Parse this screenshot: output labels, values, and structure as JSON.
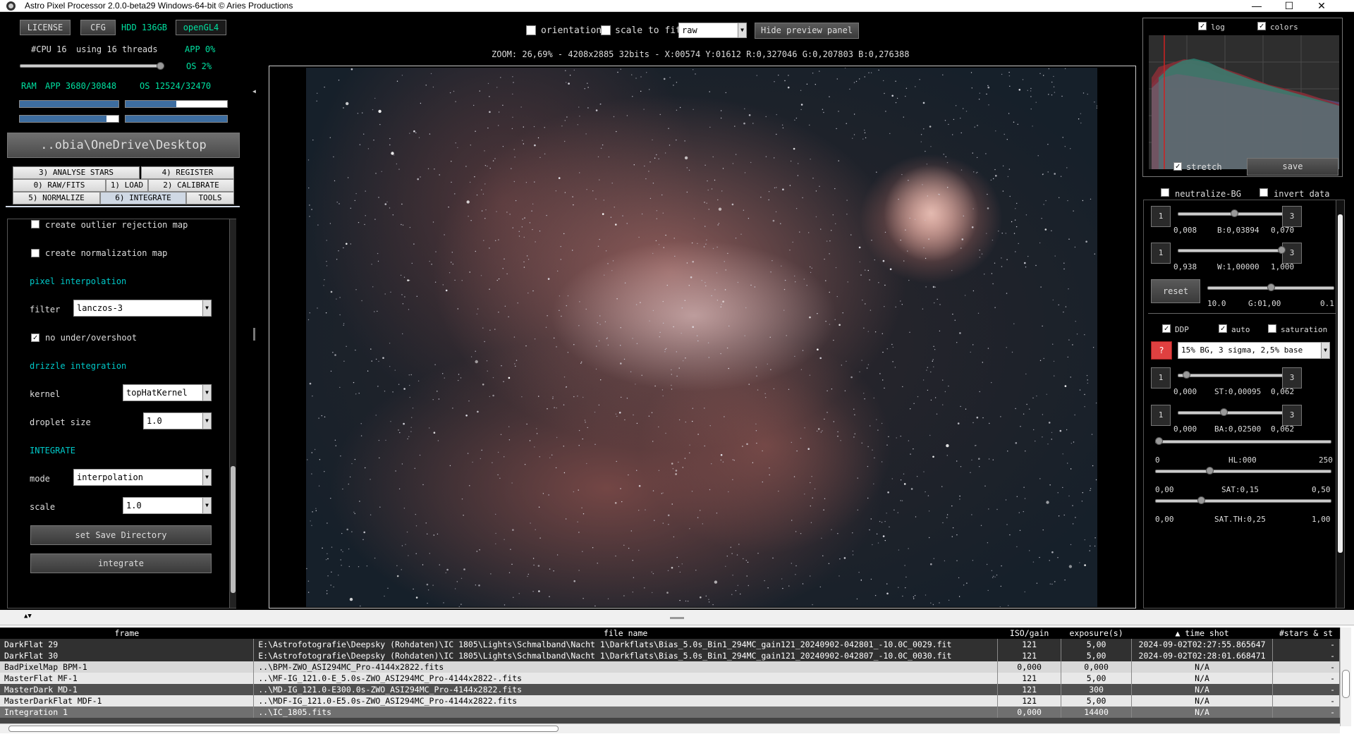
{
  "window": {
    "title": "Astro Pixel Processor 2.0.0-beta29 Windows-64-bit © Aries Productions",
    "minimize": "—",
    "maximize": "☐",
    "close": "✕"
  },
  "toolbar": {
    "license": "LICENSE",
    "cfg": "CFG",
    "hdd": "HDD 136GB",
    "opengl": "openGL4"
  },
  "sysinfo": {
    "cpu": "#CPU 16",
    "threads": "using 16 threads",
    "app_pct": "APP 0%",
    "os_pct": "OS 2%",
    "ram_label": "RAM",
    "ram_app": "APP 3680/30848",
    "ram_os": "OS 12524/32470",
    "thread_slider": 1.0
  },
  "path": "..obia\\OneDrive\\Desktop",
  "tabs": {
    "row1": [
      "3) ANALYSE STARS",
      "4) REGISTER"
    ],
    "row2": [
      "0) RAW/FITS",
      "1) LOAD",
      "2) CALIBRATE"
    ],
    "row3": [
      "5) NORMALIZE",
      "6) INTEGRATE",
      "TOOLS"
    ],
    "active": "6) INTEGRATE"
  },
  "integrate_panel": {
    "outlier_map": "create outlier rejection map",
    "norm_map": "create normalization map",
    "pixel_interp_heading": "pixel interpolation",
    "filter_label": "filter",
    "filter_value": "lanczos-3",
    "no_overshoot": "no under/overshoot",
    "drizzle_heading": "drizzle integration",
    "kernel_label": "kernel",
    "kernel_value": "topHatKernel",
    "droplet_label": "droplet size",
    "droplet_value": "1.0",
    "integrate_heading": "INTEGRATE",
    "mode_label": "mode",
    "mode_value": "interpolation",
    "scale_label": "scale",
    "scale_value": "1.0",
    "save_dir_btn": "set Save Directory",
    "integrate_btn": "integrate"
  },
  "preview": {
    "orientation": "orientation",
    "scale_to_fit": "scale to fit",
    "mode": "raw",
    "hide_btn": "Hide preview panel",
    "zoom_info": "ZOOM: 26,69% - 4208x2885 32bits - X:00574 Y:01612 R:0,327046 G:0,207803 B:0,276388"
  },
  "histogram": {
    "log": "log",
    "colors": "colors"
  },
  "right_panel": {
    "stretch": "stretch",
    "save": "save",
    "neutralize": "neutralize-BG",
    "invert": "invert data",
    "b_min": "0,008",
    "b_val": "B:0,03894",
    "b_max": "0,070",
    "b_pos": 0.5,
    "w_min": "0,938",
    "w_val": "W:1,00000",
    "w_max": "1,000",
    "w_pos": 0.95,
    "reset": "reset",
    "g_min": "10.0",
    "g_val": "G:01,00",
    "g_max": "0.1",
    "g_pos": 0.5,
    "ddp": "DDP",
    "auto": "auto",
    "saturation": "saturation",
    "help": "?",
    "preset": "15% BG, 3 sigma, 2,5% base",
    "st_min": "0,000",
    "st_val": "ST:0,00095",
    "st_max": "0,062",
    "st_pos": 0.05,
    "ba_min": "0,000",
    "ba_val": "BA:0,02500",
    "ba_max": "0,062",
    "ba_pos": 0.4,
    "hl_min": "0",
    "hl_val": "HL:000",
    "hl_max": "250",
    "hl_pos": 0.0,
    "sat_min": "0,00",
    "sat_val": "SAT:0,15",
    "sat_max": "0,50",
    "sat_pos": 0.3,
    "satth_min": "0,00",
    "satth_val": "SAT.TH:0,25",
    "satth_max": "1,00",
    "satth_pos": 0.25,
    "step1": "1",
    "step3": "3"
  },
  "file_table": {
    "headers": [
      "frame",
      "file name",
      "ISO/gain",
      "exposure(s)",
      "▲ time shot",
      "#stars & st"
    ],
    "rows": [
      [
        "DarkFlat 29",
        "E:\\Astrofotografie\\Deepsky (Rohdaten)\\IC 1805\\Lights\\Schmalband\\Nacht 1\\Darkflats\\Bias_5.0s_Bin1_294MC_gain121_20240902-042801_-10.0C_0029.fit",
        "121",
        "5,00",
        "2024-09-02T02:27:55.865647",
        "-"
      ],
      [
        "DarkFlat 30",
        "E:\\Astrofotografie\\Deepsky (Rohdaten)\\IC 1805\\Lights\\Schmalband\\Nacht 1\\Darkflats\\Bias_5.0s_Bin1_294MC_gain121_20240902-042807_-10.0C_0030.fit",
        "121",
        "5,00",
        "2024-09-02T02:28:01.668471",
        "-"
      ],
      [
        "BadPixelMap  BPM-1",
        "..\\BPM-ZWO_ASI294MC_Pro-4144x2822.fits",
        "0,000",
        "0,000",
        "N/A",
        "-"
      ],
      [
        "MasterFlat  MF-1",
        "..\\MF-IG_121.0-E_5.0s-ZWO_ASI294MC_Pro-4144x2822-.fits",
        "121",
        "5,00",
        "N/A",
        "-"
      ],
      [
        "MasterDark  MD-1",
        "..\\MD-IG_121.0-E300.0s-ZWO_ASI294MC_Pro-4144x2822.fits",
        "121",
        "300",
        "N/A",
        "-"
      ],
      [
        "MasterDarkFlat  MDF-1",
        "..\\MDF-IG_121.0-E5.0s-ZWO_ASI294MC_Pro-4144x2822.fits",
        "121",
        "5,00",
        "N/A",
        "-"
      ],
      [
        "Integration 1",
        "..\\IC_1805.fits",
        "0,000",
        "14400",
        "N/A",
        "-"
      ]
    ]
  },
  "colors": {
    "accent_green": "#00e0a0",
    "accent_cyan": "#00c8c8",
    "help_red": "#e04040"
  }
}
